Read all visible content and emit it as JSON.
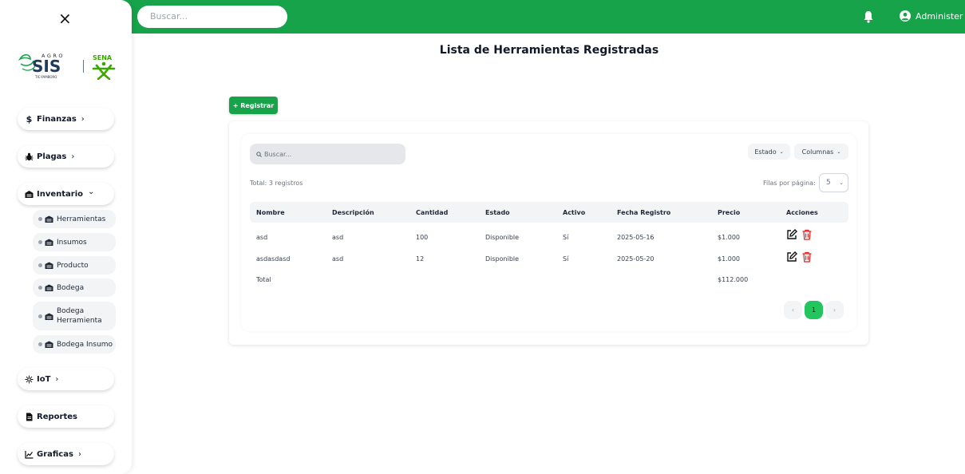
{
  "topbar": {
    "search_placeholder": "Buscar...",
    "bell_icon": "bell-icon",
    "user_icon": "user-circle-icon",
    "user_name": "Administer",
    "color": "#16a34a"
  },
  "sidebar": {
    "close": "×",
    "logo": {
      "brand_top": "AGRO",
      "brand_main": "SIS",
      "brand_sub": "TIC-YAMBORO",
      "partner": "SENA"
    },
    "items": [
      {
        "label": "Finanzas",
        "icon": "dollar-icon",
        "chevron": "›"
      },
      {
        "label": "Plagas",
        "icon": "bug-icon",
        "chevron": "›"
      },
      {
        "label": "Inventario",
        "icon": "warehouse-icon",
        "chevron": "⌄"
      },
      {
        "label": "IoT",
        "icon": "sensor-icon",
        "chevron": "›"
      },
      {
        "label": "Reportes",
        "icon": "document-icon",
        "chevron": ""
      },
      {
        "label": "Graficas",
        "icon": "chart-icon",
        "chevron": "›"
      }
    ],
    "sub_items": [
      {
        "label": "Herramientas"
      },
      {
        "label": "Insumos"
      },
      {
        "label": "Producto"
      },
      {
        "label": "Bodega"
      },
      {
        "label": "Bodega Herramienta"
      },
      {
        "label": "Bodega Insumo"
      }
    ]
  },
  "main": {
    "title": "Lista de Herramientas Registradas",
    "register_button": "+ Registrar",
    "table_search_placeholder": "Buscar...",
    "filter_estado": "Estado",
    "filter_columnas": "Columnas",
    "total_records": "Total: 3 registros",
    "rows_per_page_label": "Filas por página:",
    "rows_per_page_value": "5",
    "columns": [
      "Nombre",
      "Descripción",
      "Cantidad",
      "Estado",
      "Activo",
      "Fecha Registro",
      "Precio",
      "Acciones"
    ],
    "rows": [
      {
        "nombre": "asd",
        "descripcion": "asd",
        "cantidad": "100",
        "estado": "Disponible",
        "activo": "Sí",
        "fecha": "2025-05-16",
        "precio": "$1.000"
      },
      {
        "nombre": "asdasdasd",
        "descripcion": "asd",
        "cantidad": "12",
        "estado": "Disponible",
        "activo": "Sí",
        "fecha": "2025-05-20",
        "precio": "$1.000"
      }
    ],
    "total_label": "Total",
    "total_value": "$112.000",
    "pagination": {
      "prev": "‹",
      "current": "1",
      "next": "›"
    },
    "colors": {
      "accent": "#16a34a",
      "page_active": "#22c55e",
      "delete": "#dc2626"
    }
  }
}
